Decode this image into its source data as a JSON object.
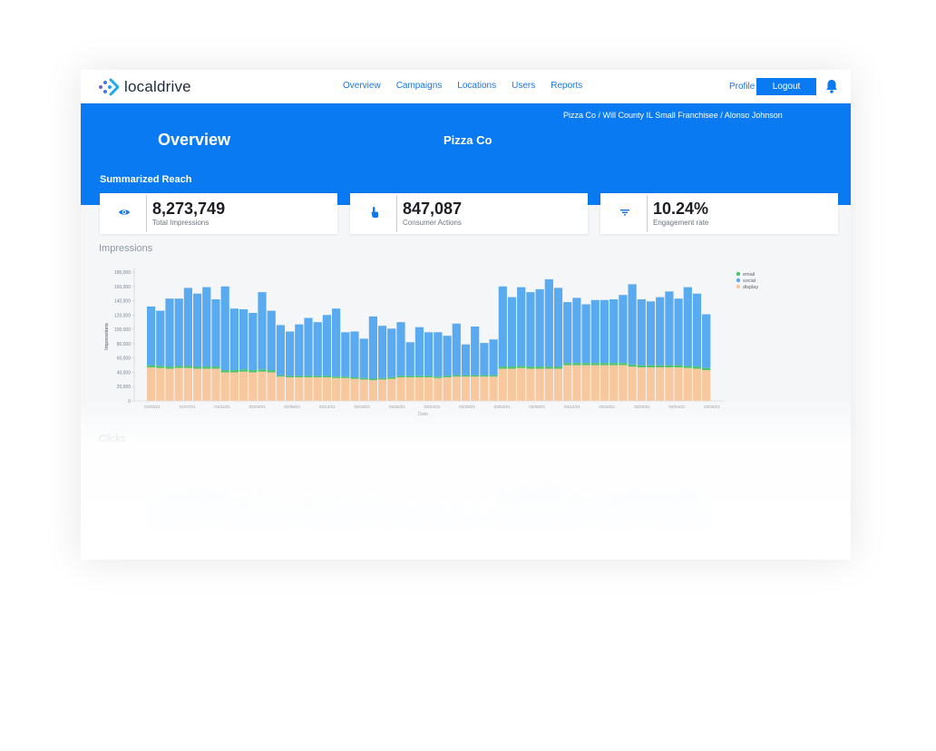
{
  "nav": {
    "brand": "localdrive",
    "links": [
      "Overview",
      "Campaigns",
      "Locations",
      "Users",
      "Reports"
    ],
    "profile": "Profile",
    "logout": "Logout"
  },
  "header": {
    "breadcrumb": "Pizza Co / Will County IL Small Franchisee / Alonso Johnson",
    "title": "Overview",
    "company": "Pizza Co",
    "section": "Summarized Reach"
  },
  "stats": [
    {
      "value": "8,273,749",
      "label": "Total Impressions",
      "icon": "eye-icon"
    },
    {
      "value": "847,087",
      "label": "Consumer Actions",
      "icon": "touch-icon"
    },
    {
      "value": "10.24%",
      "label": "Engagement rate",
      "icon": "filter-icon"
    }
  ],
  "colors": {
    "primary": "#0a7af2",
    "email": "#4cc46b",
    "social": "#5aaaf0",
    "display": "#f7c79e"
  },
  "impressions_title": "Impressions",
  "clicks_title": "Clicks",
  "chart_data": {
    "type": "bar",
    "stacked": true,
    "xlabel": "Date",
    "ylabel": "Impressions",
    "ylim": [
      0,
      180000
    ],
    "yticks": [
      "0",
      "20,000",
      "40,000",
      "60,000",
      "80,000",
      "100,000",
      "120,000",
      "140,000",
      "160,000",
      "180,000"
    ],
    "xtick_labels": [
      "01/03/21",
      "01/07/21",
      "01/11/21",
      "02/04/21",
      "02/08/21",
      "02/12/21",
      "02/16/21",
      "02/20/21",
      "02/24/21",
      "02/28/21",
      "03/04/21",
      "03/08/21",
      "03/12/21",
      "03/16/21",
      "03/20/21",
      "03/24/21",
      "03/28/21"
    ],
    "legend": [
      "email",
      "social",
      "display"
    ],
    "legend_position": "top-right",
    "series": [
      {
        "name": "display",
        "values": [
          47000,
          46000,
          45000,
          46000,
          46000,
          45000,
          45000,
          45000,
          40000,
          40000,
          41000,
          40000,
          41000,
          40000,
          34000,
          33000,
          33000,
          33000,
          33000,
          33000,
          32000,
          32000,
          31000,
          30000,
          29000,
          30000,
          31000,
          33000,
          33000,
          33000,
          33000,
          32000,
          33000,
          34000,
          34000,
          34000,
          34000,
          34000,
          45000,
          45000,
          46000,
          45000,
          45000,
          45000,
          45000,
          50000,
          50000,
          50000,
          50000,
          50000,
          50000,
          50000,
          48000,
          47000,
          47000,
          47000,
          47000,
          47000,
          46000,
          45000,
          43000
        ]
      },
      {
        "name": "email",
        "values": [
          3000,
          3000,
          3000,
          3000,
          3000,
          3000,
          3000,
          3000,
          3000,
          3000,
          3000,
          3000,
          3000,
          3000,
          2000,
          2000,
          2000,
          2000,
          2000,
          2000,
          2000,
          2000,
          2000,
          2000,
          2000,
          2000,
          2000,
          2000,
          2000,
          2000,
          2000,
          2000,
          2000,
          2000,
          2000,
          2000,
          2000,
          2000,
          3000,
          3000,
          3000,
          3000,
          3000,
          3000,
          3000,
          3000,
          3000,
          3000,
          3000,
          3000,
          3000,
          3000,
          3000,
          3000,
          3000,
          3000,
          3000,
          3000,
          3000,
          3000,
          3000
        ]
      },
      {
        "name": "social",
        "values": [
          82000,
          77000,
          95000,
          94000,
          109000,
          102000,
          111000,
          94000,
          117000,
          86000,
          84000,
          80000,
          108000,
          83000,
          70000,
          62000,
          72000,
          81000,
          75000,
          85000,
          95000,
          62000,
          64000,
          55000,
          87000,
          73000,
          68000,
          75000,
          47000,
          68000,
          61000,
          62000,
          56000,
          72000,
          43000,
          68000,
          45000,
          50000,
          112000,
          97000,
          110000,
          104000,
          108000,
          122000,
          110000,
          85000,
          91000,
          82000,
          88000,
          88000,
          89000,
          95000,
          112000,
          92000,
          89000,
          95000,
          103000,
          93000,
          110000,
          102000,
          75000
        ]
      }
    ]
  }
}
